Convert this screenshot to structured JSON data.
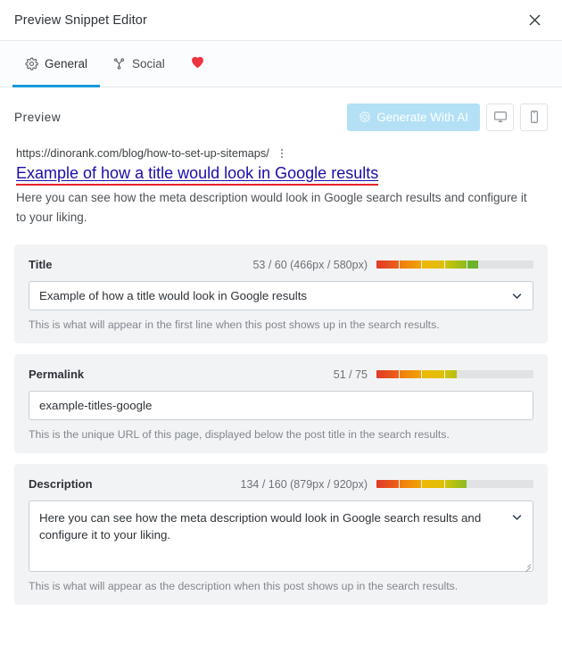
{
  "window": {
    "title": "Preview Snippet Editor",
    "close_icon": "close-icon"
  },
  "tabs": [
    {
      "label": "General",
      "icon": "gear-icon",
      "active": true
    },
    {
      "label": "Social",
      "icon": "share-nodes-icon",
      "active": false
    }
  ],
  "favorite": {
    "icon": "heart-icon",
    "color": "#ef3340"
  },
  "preview": {
    "label": "Preview",
    "generate_button": {
      "label": "Generate With AI",
      "icon": "ai-circle-icon",
      "disabled": true,
      "color": "#b3e0f5"
    },
    "device_desktop": {
      "icon": "desktop-icon"
    },
    "device_mobile": {
      "icon": "mobile-icon"
    }
  },
  "serp": {
    "url": "https://dinorank.com/blog/how-to-set-up-sitemaps/",
    "menu_icon": "three-dots-vertical-icon",
    "title": "Example of how a title would look in Google results",
    "title_color": "#1a0dab",
    "title_annotation_color": "#e8202a",
    "description": "Here you can see how the meta description would look in Google search results and configure it to your liking."
  },
  "fields": [
    {
      "key": "title",
      "label": "Title",
      "counter": "53 / 60 (466px / 580px)",
      "value": "Example of how a title would look in Google results",
      "hint": "This is what will appear in the first line when this post shows up in the search results.",
      "has_chevron": true,
      "type": "input",
      "gauge": {
        "track_color": "#e0e2e4",
        "segments": [
          {
            "width_pct": 14.5,
            "from": "#e03a24",
            "to": "#ec6318"
          },
          {
            "width_pct": 14.5,
            "from": "#ef7c10",
            "to": "#f2a304"
          },
          {
            "width_pct": 14.5,
            "from": "#efb806",
            "to": "#dfc007"
          },
          {
            "width_pct": 14.5,
            "from": "#cfc40a",
            "to": "#8cba1e"
          },
          {
            "width_pct": 7.0,
            "from": "#6cb22a",
            "to": "#6cb22a"
          }
        ]
      }
    },
    {
      "key": "permalink",
      "label": "Permalink",
      "counter": "51 / 75",
      "value": "example-titles-google",
      "hint": "This is the unique URL of this page, displayed below the post title in the search results.",
      "has_chevron": false,
      "type": "input",
      "gauge": {
        "track_color": "#e0e2e4",
        "segments": [
          {
            "width_pct": 14.5,
            "from": "#e03a24",
            "to": "#ec6318"
          },
          {
            "width_pct": 14.5,
            "from": "#ef7c10",
            "to": "#f2a304"
          },
          {
            "width_pct": 14.5,
            "from": "#efb806",
            "to": "#dfc007"
          },
          {
            "width_pct": 7.5,
            "from": "#cfc40a",
            "to": "#b9bf0c"
          }
        ]
      }
    },
    {
      "key": "description",
      "label": "Description",
      "counter": "134 / 160 (879px / 920px)",
      "value": "Here you can see how the meta description would look in Google search results and configure it to your liking.",
      "hint": "This is what will appear as the description when this post shows up in the search results.",
      "has_chevron": true,
      "type": "textarea",
      "gauge": {
        "track_color": "#e0e2e4",
        "segments": [
          {
            "width_pct": 14.5,
            "from": "#e03a24",
            "to": "#ec6318"
          },
          {
            "width_pct": 14.5,
            "from": "#ef7c10",
            "to": "#f2a304"
          },
          {
            "width_pct": 14.5,
            "from": "#efb806",
            "to": "#dfc007"
          },
          {
            "width_pct": 14.0,
            "from": "#cfc40a",
            "to": "#8cba1e"
          }
        ]
      }
    }
  ]
}
